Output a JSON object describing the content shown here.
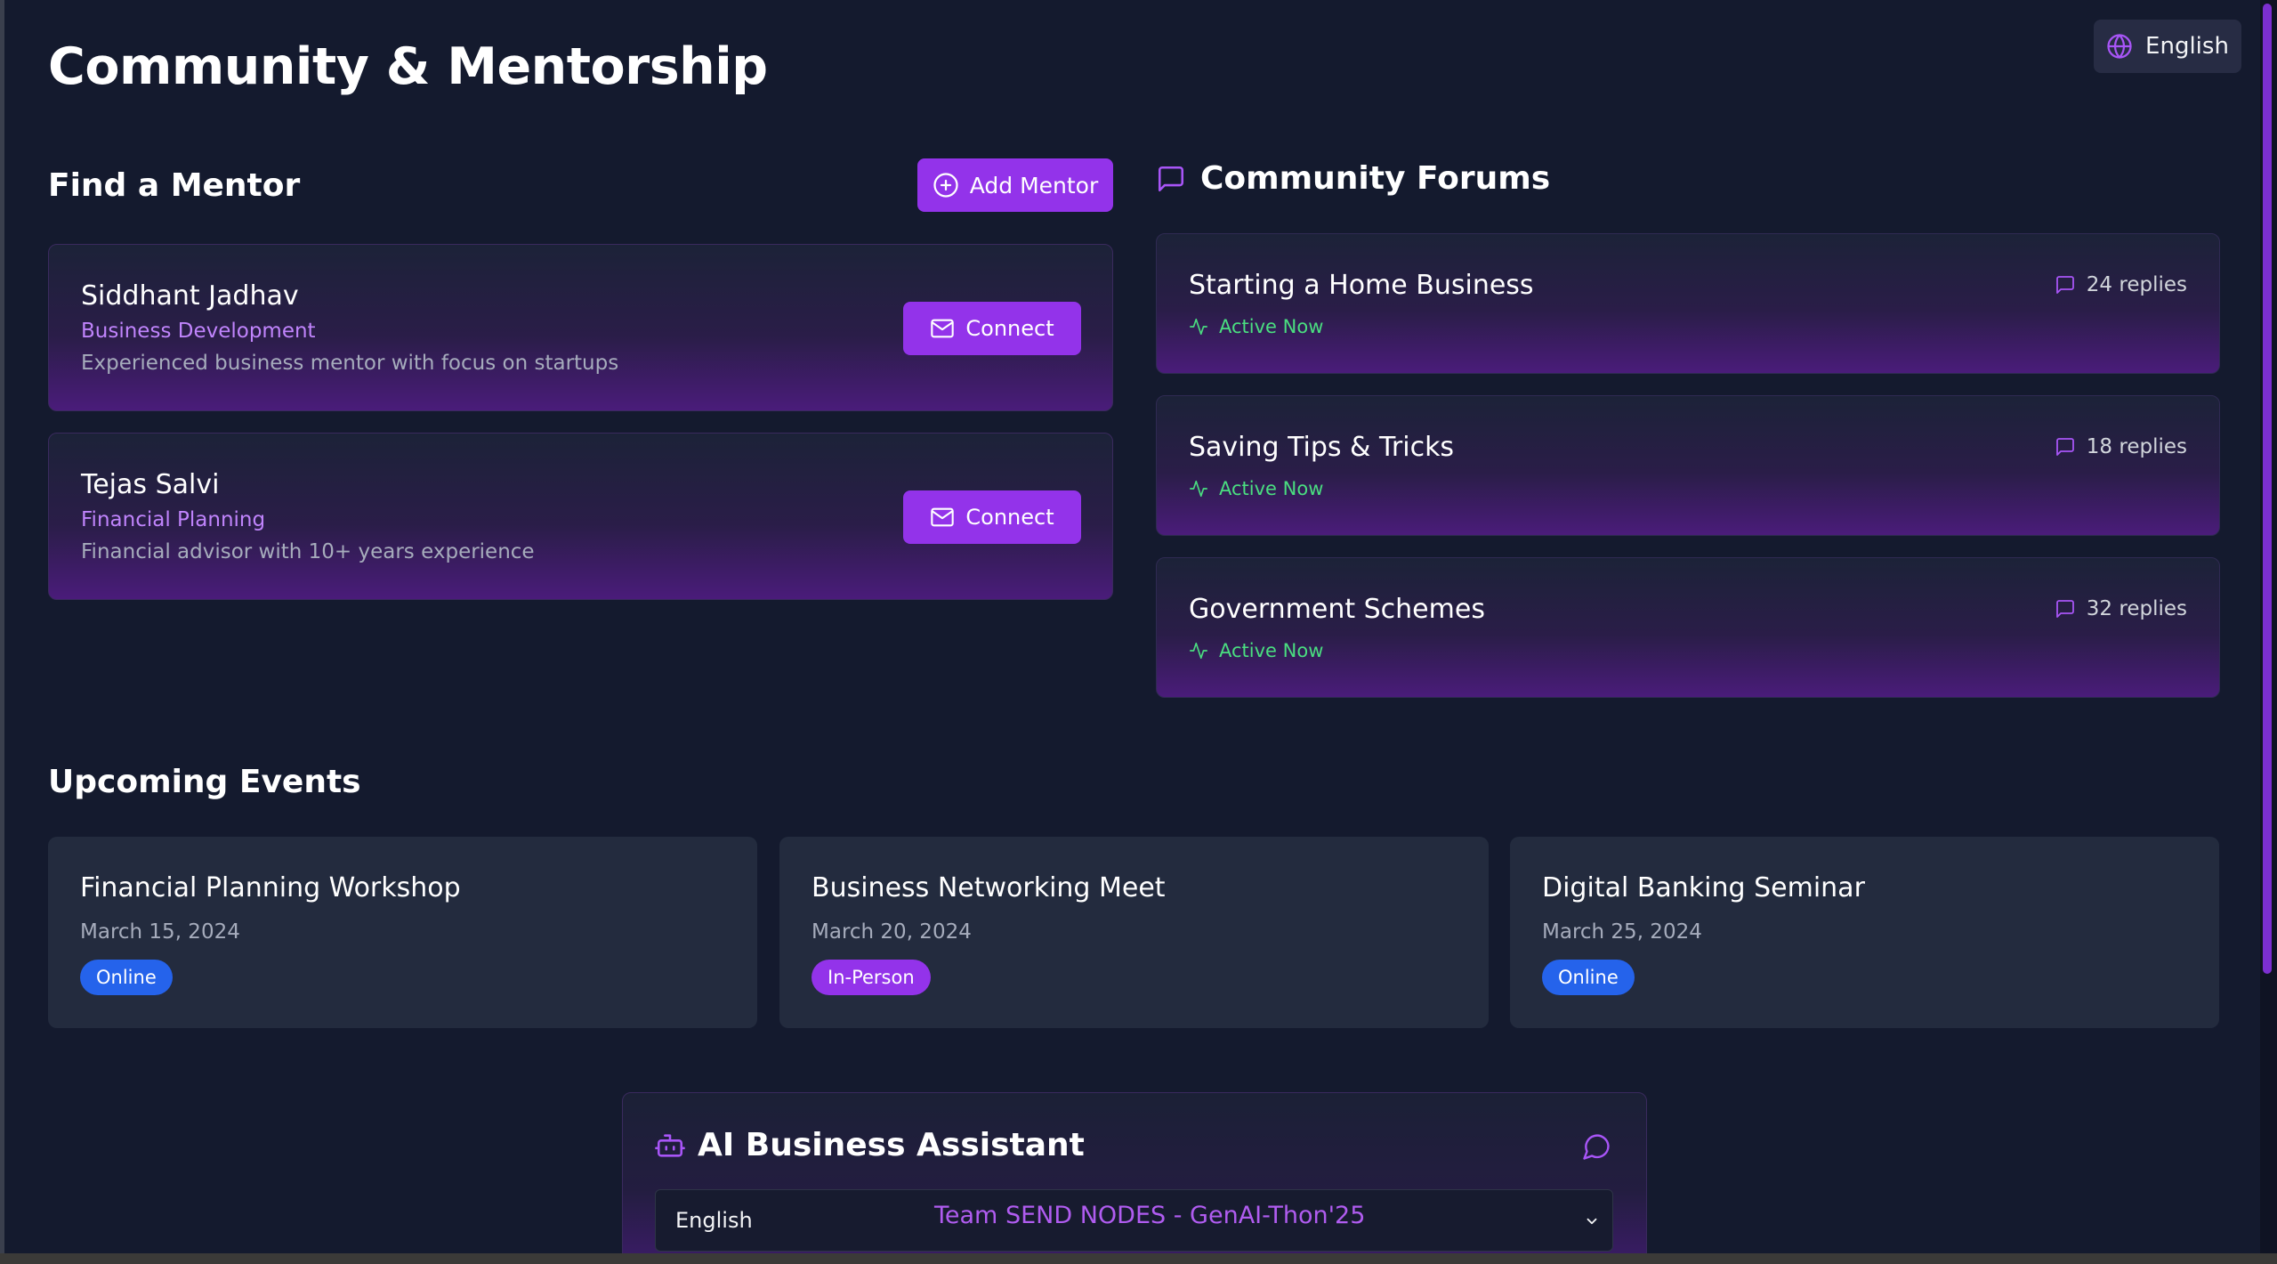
{
  "header": {
    "title": "Community & Mentorship",
    "language_label": "English"
  },
  "mentors": {
    "heading": "Find a Mentor",
    "add_label": "Add Mentor",
    "connect_label": "Connect",
    "items": [
      {
        "name": "Siddhant Jadhav",
        "role": "Business Development",
        "description": "Experienced business mentor with focus on startups"
      },
      {
        "name": "Tejas Salvi",
        "role": "Financial Planning",
        "description": "Financial advisor with 10+ years experience"
      }
    ]
  },
  "forums": {
    "heading": "Community Forums",
    "items": [
      {
        "title": "Starting a Home Business",
        "status": "Active Now",
        "replies": "24 replies"
      },
      {
        "title": "Saving Tips & Tricks",
        "status": "Active Now",
        "replies": "18 replies"
      },
      {
        "title": "Government Schemes",
        "status": "Active Now",
        "replies": "32 replies"
      }
    ]
  },
  "events": {
    "heading": "Upcoming Events",
    "items": [
      {
        "title": "Financial Planning Workshop",
        "date": "March 15, 2024",
        "mode": "Online",
        "badge_color": "#2563eb"
      },
      {
        "title": "Business Networking Meet",
        "date": "March 20, 2024",
        "mode": "In-Person",
        "badge_color": "#9333ea"
      },
      {
        "title": "Digital Banking Seminar",
        "date": "March 25, 2024",
        "mode": "Online",
        "badge_color": "#2563eb"
      }
    ]
  },
  "assistant": {
    "title": "AI Business Assistant",
    "language_value": "English",
    "team_credit": "Team SEND NODES - GenAI-Thon'25"
  },
  "colors": {
    "accent": "#9333ea",
    "accent_text": "#c084fc",
    "active": "#4ade80",
    "background": "#141a2e"
  },
  "icons": {
    "language": "globe-icon",
    "add": "plus-circle-icon",
    "connect": "mail-icon",
    "forums": "message-square-icon",
    "activity": "activity-icon",
    "replies": "message-square-icon",
    "assistant": "bot-icon",
    "chat": "message-circle-icon",
    "select": "chevron-down-icon"
  }
}
